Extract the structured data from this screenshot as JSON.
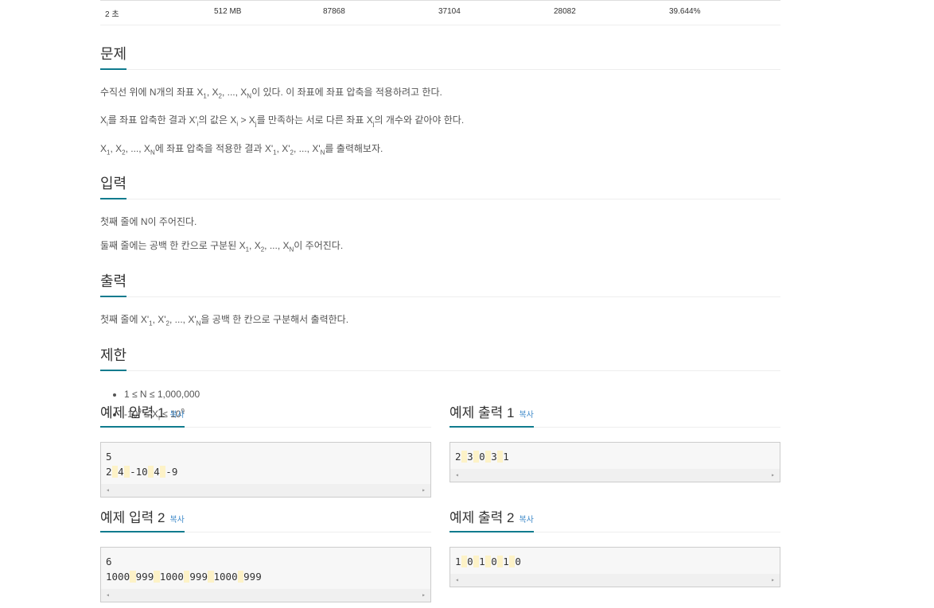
{
  "stats": {
    "time": "2 초",
    "memory": "512 MB",
    "submissions": "87868",
    "accepted": "37104",
    "solved": "28082",
    "ratio": "39.644%"
  },
  "problem": {
    "title": "문제",
    "line1": {
      "a": "수직선 위에 N개의 좌표 X",
      "s1": "1",
      "b": ", X",
      "s2": "2",
      "c": ", ..., X",
      "sN": "N",
      "d": "이 있다. 이 좌표에 좌표 압축을 적용하려고 한다."
    },
    "line2": {
      "a": "X",
      "si": "i",
      "b": "를 좌표 압축한 결과 X'",
      "si2": "i",
      "c": "의 값은 X",
      "si3": "i",
      "d": " > X",
      "sj": "j",
      "e": "를 만족하는 서로 다른 좌표 X",
      "sj2": "j",
      "f": "의 개수와 같아야 한다."
    },
    "line3": {
      "a": "X",
      "s1": "1",
      "b": ", X",
      "s2": "2",
      "c": ", ..., X",
      "sN": "N",
      "d": "에 좌표 압축을 적용한 결과 X'",
      "s1b": "1",
      "e": ", X'",
      "s2b": "2",
      "f": ", ..., X'",
      "sNb": "N",
      "g": "를 출력해보자."
    }
  },
  "input": {
    "title": "입력",
    "line1": "첫째 줄에 N이 주어진다.",
    "line2": {
      "a": "둘째 줄에는 공백 한 칸으로 구분된 X",
      "s1": "1",
      "b": ", X",
      "s2": "2",
      "c": ", ..., X",
      "sN": "N",
      "d": "이 주어진다."
    }
  },
  "output": {
    "title": "출력",
    "line1": {
      "a": "첫째 줄에 X'",
      "s1": "1",
      "b": ", X'",
      "s2": "2",
      "c": ", ..., X'",
      "sN": "N",
      "d": "을 공백 한 칸으로 구분해서 출력한다."
    }
  },
  "limits": {
    "title": "제한",
    "item1": "1 ≤ N ≤ 1,000,000",
    "item2": {
      "a": "-10",
      "sup1": "9",
      "b": " ≤ X",
      "si": "i",
      "c": " ≤ 10",
      "sup2": "9"
    }
  },
  "samples": {
    "copy_label": "복사",
    "in1": {
      "title": "예제 입력 1",
      "line1": "5",
      "tokens2": [
        "2",
        "4",
        "-10",
        "4",
        "-9"
      ]
    },
    "out1": {
      "title": "예제 출력 1",
      "tokens1": [
        "2",
        "3",
        "0",
        "3",
        "1"
      ]
    },
    "in2": {
      "title": "예제 입력 2",
      "line1": "6",
      "tokens2": [
        "1000",
        "999",
        "1000",
        "999",
        "1000",
        "999"
      ]
    },
    "out2": {
      "title": "예제 출력 2",
      "tokens1": [
        "1",
        "0",
        "1",
        "0",
        "1",
        "0"
      ]
    }
  },
  "icons": {
    "scroll_left": "◂",
    "scroll_right": "▸"
  }
}
